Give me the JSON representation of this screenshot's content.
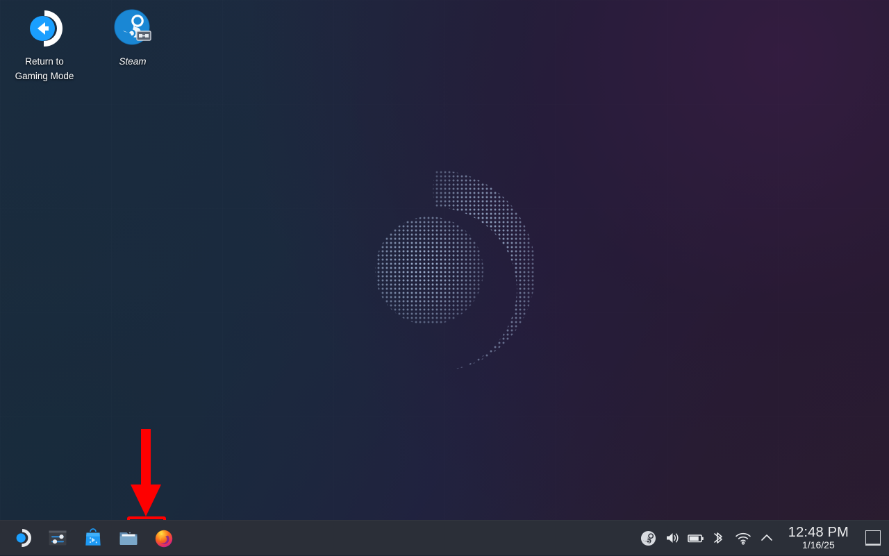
{
  "desktop": {
    "wallpaper": {
      "name": "steamos-halftone-logo-wallpaper",
      "gradient_start": "#1c2a3c",
      "gradient_end": "#2a1c2e",
      "logo_dot_color": "#9fb6d8"
    },
    "icons": [
      {
        "id": "return-to-gaming-mode",
        "icon": "return-to-gaming-mode-icon",
        "label": "Return to\nGaming Mode",
        "label_line1": "Return to",
        "label_line2": "Gaming Mode",
        "accent": "#1a9fff"
      },
      {
        "id": "steam",
        "icon": "steam-icon",
        "label": "Steam",
        "badge": "shortcut-link-badge",
        "accent": "#1a9fff"
      }
    ]
  },
  "annotations": {
    "arrow": {
      "name": "red-pointer-arrow",
      "color": "#fe0000",
      "direction": "down",
      "points_to": "file-manager-launcher"
    },
    "highlight_box": {
      "name": "red-highlight-box",
      "color": "#fe0000",
      "targets": "file-manager-launcher"
    }
  },
  "taskbar": {
    "background": "#2b2f38",
    "launchers": [
      {
        "id": "app-launcher",
        "icon": "steamos-launcher-icon",
        "label": "Application Launcher",
        "color": "#1a9fff"
      },
      {
        "id": "system-settings",
        "icon": "settings-sliders-icon",
        "label": "System Settings",
        "color": "#3b83c4"
      },
      {
        "id": "discover",
        "icon": "discover-bag-icon",
        "label": "Discover",
        "color": "#1d99f3"
      },
      {
        "id": "file-manager",
        "icon": "folder-icon",
        "label": "File Manager",
        "color": "#7fa8cc"
      },
      {
        "id": "firefox",
        "icon": "firefox-icon",
        "label": "Firefox",
        "color": "#ff8a1f"
      }
    ],
    "systray": [
      {
        "id": "steam-tray",
        "icon": "steam-icon",
        "label": "Steam"
      },
      {
        "id": "volume",
        "icon": "speaker-volume-icon",
        "label": "Volume"
      },
      {
        "id": "battery",
        "icon": "battery-icon",
        "label": "Battery"
      },
      {
        "id": "bluetooth",
        "icon": "bluetooth-icon",
        "label": "Bluetooth"
      },
      {
        "id": "network",
        "icon": "wifi-icon",
        "label": "Networks"
      },
      {
        "id": "expand-tray",
        "icon": "chevron-up-icon",
        "label": "Show hidden icons"
      }
    ],
    "clock": {
      "time": "12:48 PM",
      "date": "1/16/25"
    },
    "show_desktop": {
      "icon": "show-desktop-icon",
      "label": "Show Desktop"
    }
  }
}
